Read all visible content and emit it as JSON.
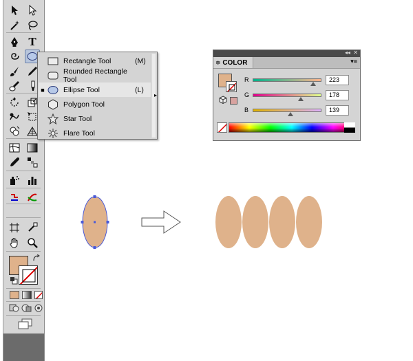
{
  "colors": {
    "fill": "#dfb28b",
    "selection": "#4a5ad8",
    "flyout_bg": "#d4d4d4",
    "panel_dark": "#4a4a4a"
  },
  "toolbar": {
    "icons": [
      [
        "selection-arrow-icon",
        "direct-selection-arrow-icon"
      ],
      [
        "magic-wand-icon",
        "lasso-icon"
      ],
      [
        "pen-icon",
        "type-icon"
      ],
      [
        "spiral-icon",
        "ellipse-icon"
      ],
      [
        "paintbrush-icon",
        "pencil-icon"
      ],
      [
        "blob-brush-icon",
        "eraser-icon"
      ],
      [
        "rotate-icon",
        "scale-icon"
      ],
      [
        "warp-icon",
        "free-transform-icon"
      ],
      [
        "shape-builder-icon",
        "perspective-grid-icon"
      ],
      [
        "mesh-icon",
        "gradient-icon"
      ],
      [
        "eyedropper-icon",
        "blend-icon"
      ],
      [
        "symbol-sprayer-icon",
        "column-graph-icon"
      ],
      [
        "slice-icon",
        "knife-icon"
      ],
      [
        "artboard-icon",
        "slice-select-icon"
      ],
      [
        "hand-icon",
        "zoom-icon"
      ]
    ],
    "type_tool_glyph": "T"
  },
  "flyout": {
    "items": [
      {
        "label": "Rectangle Tool",
        "shortcut": "(M)",
        "icon": "rectangle-icon",
        "selected": false
      },
      {
        "label": "Rounded Rectangle Tool",
        "shortcut": "",
        "icon": "rounded-rectangle-icon",
        "selected": false
      },
      {
        "label": "Ellipse Tool",
        "shortcut": "(L)",
        "icon": "ellipse-icon",
        "selected": true
      },
      {
        "label": "Polygon Tool",
        "shortcut": "",
        "icon": "polygon-icon",
        "selected": false
      },
      {
        "label": "Star Tool",
        "shortcut": "",
        "icon": "star-icon",
        "selected": false
      },
      {
        "label": "Flare Tool",
        "shortcut": "",
        "icon": "flare-icon",
        "selected": false
      }
    ],
    "bullet": "■"
  },
  "color_panel": {
    "tab_label": "COLOR",
    "tab_glyph": "≑",
    "menu_glyph": "▾≡",
    "collapse_glyph": "◂◂",
    "close_glyph": "✕",
    "channels": [
      {
        "label": "R",
        "value": "223",
        "position": 0.875
      },
      {
        "label": "G",
        "value": "178",
        "position": 0.698
      },
      {
        "label": "B",
        "value": "139",
        "position": 0.545
      }
    ],
    "small_swatch_color": "#d8a3a0"
  }
}
